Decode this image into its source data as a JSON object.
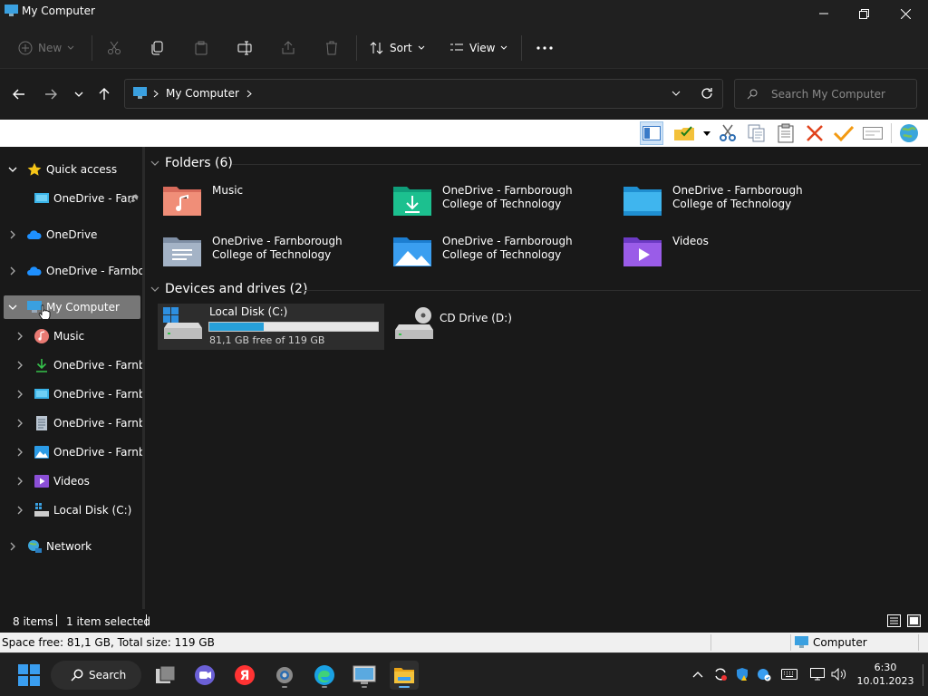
{
  "window": {
    "title": "My Computer",
    "controls": {
      "minimize": "minimize-icon",
      "maximize": "restore-icon",
      "close": "close-icon"
    }
  },
  "commandbar": {
    "new_label": "New",
    "sort_label": "Sort",
    "view_label": "View",
    "more": "more-icon"
  },
  "addressbar": {
    "crumbs": [
      "My Computer"
    ],
    "search_placeholder": "Search My Computer"
  },
  "sidebar": {
    "items": [
      {
        "label": "Quick access",
        "icon": "star-icon"
      },
      {
        "label": "OneDrive - Farr",
        "icon": "desktop-folder-icon",
        "pinned": true
      },
      {
        "label": "OneDrive",
        "icon": "cloud-icon"
      },
      {
        "label": "OneDrive - Farnborough College of Technology",
        "icon": "cloud-icon"
      },
      {
        "label": "My Computer",
        "icon": "computer-icon",
        "selected": true
      },
      {
        "label": "Music",
        "icon": "music-icon"
      },
      {
        "label": "OneDrive - Farnborough College of Technology",
        "icon": "download-icon"
      },
      {
        "label": "OneDrive - Farnborough College of Technology",
        "icon": "desktop-folder-icon"
      },
      {
        "label": "OneDrive - Farnborough College of Technology",
        "icon": "document-icon"
      },
      {
        "label": "OneDrive - Farnborough College of Technology",
        "icon": "pictures-icon"
      },
      {
        "label": "Videos",
        "icon": "videos-icon"
      },
      {
        "label": "Local Disk (C:)",
        "icon": "drive-icon"
      },
      {
        "label": "Network",
        "icon": "network-icon"
      }
    ]
  },
  "folders": {
    "heading": "Folders (6)",
    "items": [
      {
        "label": "Music",
        "icon": "music-folder-icon"
      },
      {
        "label": "OneDrive - Farnborough College of Technology",
        "icon": "downloads-folder-icon"
      },
      {
        "label": "OneDrive - Farnborough College of Technology",
        "icon": "desktop-folder-icon"
      },
      {
        "label": "OneDrive - Farnborough College of Technology",
        "icon": "documents-folder-icon"
      },
      {
        "label": "OneDrive - Farnborough College of Technology",
        "icon": "pictures-folder-icon"
      },
      {
        "label": "Videos",
        "icon": "videos-folder-icon"
      }
    ]
  },
  "drives": {
    "heading": "Devices and drives (2)",
    "local": {
      "label": "Local Disk (C:)",
      "free_text": "81,1 GB free of 119 GB",
      "used_fraction": 0.32
    },
    "cd": {
      "label": "CD Drive (D:)"
    }
  },
  "status": {
    "items": "8 items",
    "selected": "1 item selected"
  },
  "classic_status": {
    "space": "Space free: 81,1 GB, Total size: 119 GB",
    "location": "Computer"
  },
  "taskbar": {
    "search_label": "Search",
    "time": "6:30",
    "date": "10.01.2023"
  },
  "colors": {
    "accent": "#26a0da",
    "selection": "#777777",
    "folder_yellow": "#f3c13a"
  }
}
